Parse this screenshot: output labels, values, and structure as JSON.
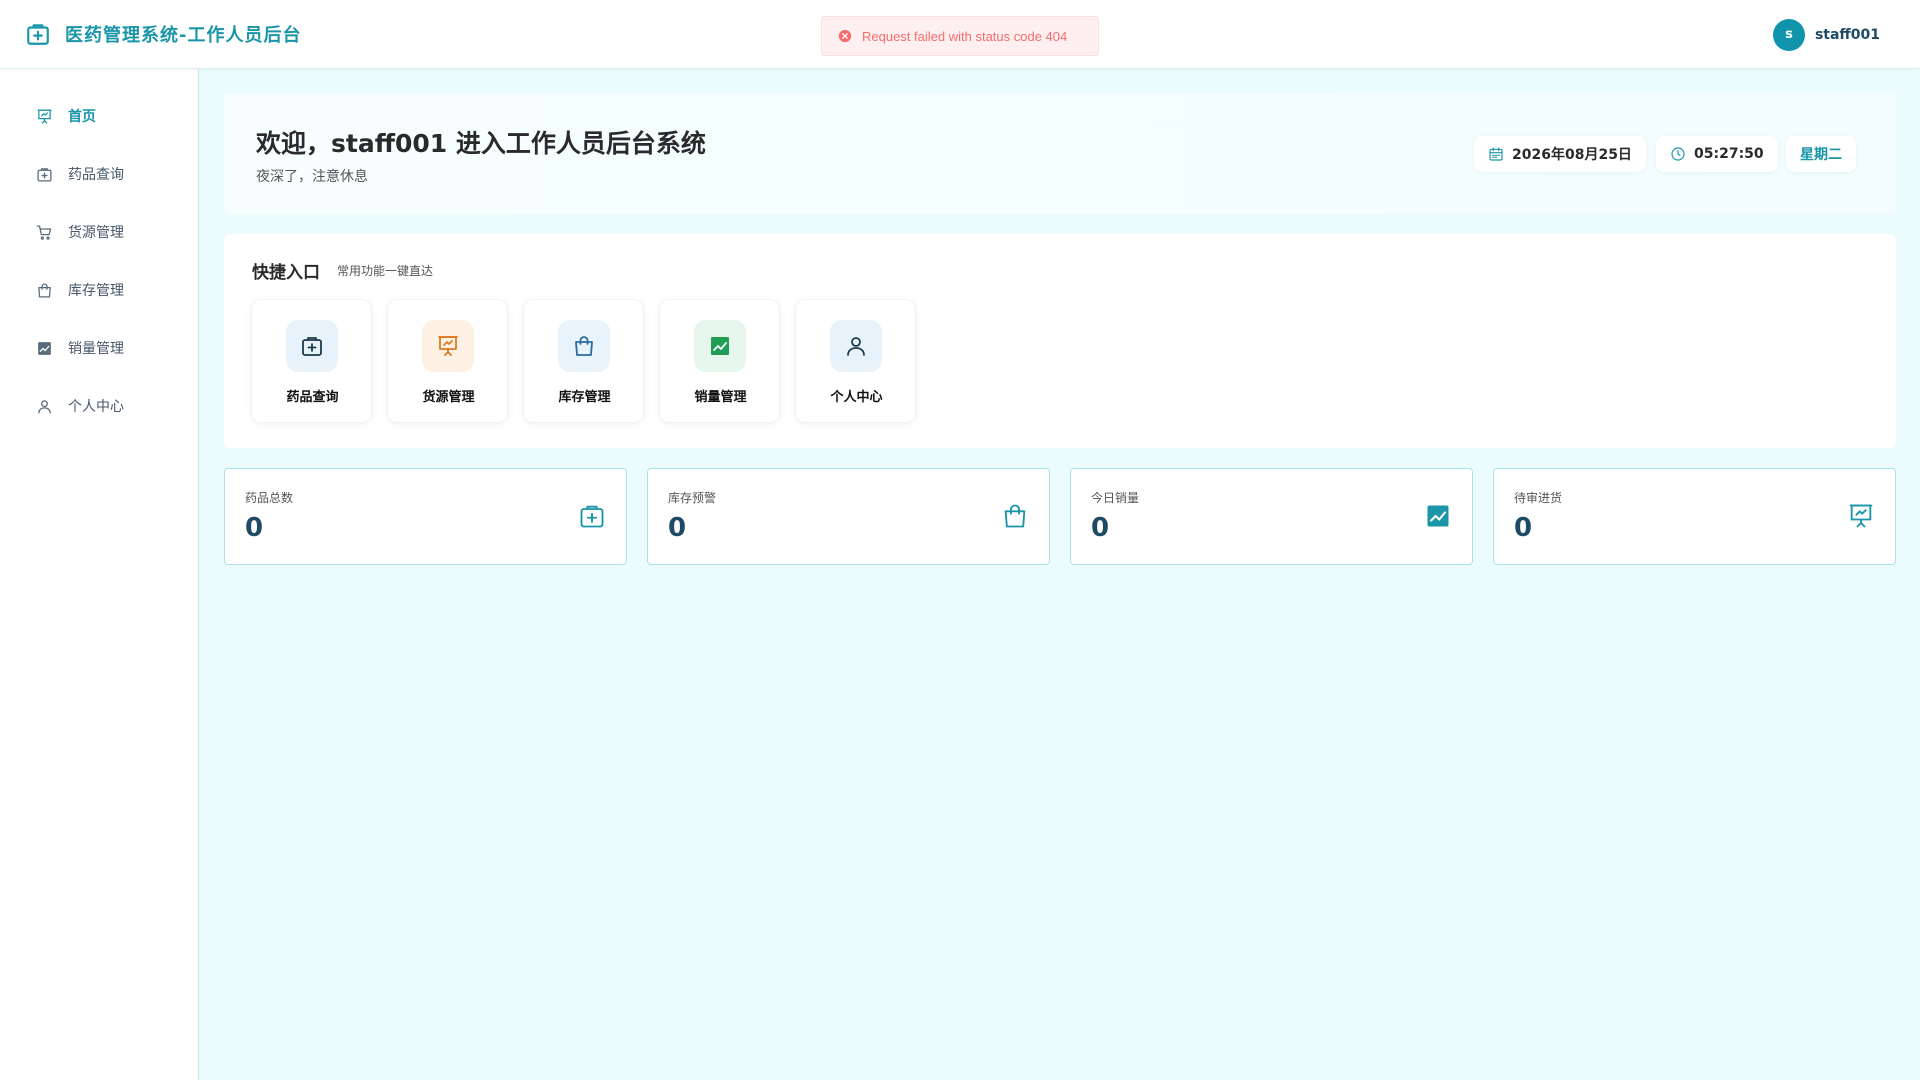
{
  "header": {
    "title": "医药管理系统-工作人员后台",
    "user": {
      "avatar_letter": "s",
      "name": "staff001"
    }
  },
  "toast": {
    "message": "Request failed with status code 404",
    "color": "#f56c6c"
  },
  "sidebar": {
    "items": [
      {
        "label": "首页",
        "icon": "chart-board-icon",
        "active": true
      },
      {
        "label": "药品查询",
        "icon": "medkit-icon",
        "active": false
      },
      {
        "label": "货源管理",
        "icon": "cart-icon",
        "active": false
      },
      {
        "label": "库存管理",
        "icon": "bag-icon",
        "active": false
      },
      {
        "label": "销量管理",
        "icon": "trend-chart-icon",
        "active": false
      },
      {
        "label": "个人中心",
        "icon": "user-icon",
        "active": false
      }
    ]
  },
  "welcome": {
    "title": "欢迎，staff001 进入工作人员后台系统",
    "subtitle": "夜深了，注意休息",
    "date": "2026年08月25日",
    "time": "05:27:50",
    "weekday": "星期二"
  },
  "quick": {
    "title": "快捷入口",
    "subtitle": "常用功能一键直达",
    "items": [
      {
        "label": "药品查询",
        "icon": "medkit-icon",
        "bg": "#e8f2fb",
        "color": "#1f3b4d"
      },
      {
        "label": "货源管理",
        "icon": "chart-board-icon",
        "bg": "#fdf1e5",
        "color": "#e07b1f"
      },
      {
        "label": "库存管理",
        "icon": "bag-icon",
        "bg": "#e8f3fb",
        "color": "#2b6c9e"
      },
      {
        "label": "销量管理",
        "icon": "trend-chart-icon",
        "bg": "#e6f6ec",
        "color": "#1f9e55"
      },
      {
        "label": "个人中心",
        "icon": "user-icon",
        "bg": "#e8f2fb",
        "color": "#1f3b4d"
      }
    ]
  },
  "stats": [
    {
      "label": "药品总数",
      "value": "0",
      "icon": "medkit-icon"
    },
    {
      "label": "库存预警",
      "value": "0",
      "icon": "bag-icon"
    },
    {
      "label": "今日销量",
      "value": "0",
      "icon": "trend-chart-icon"
    },
    {
      "label": "待审进货",
      "value": "0",
      "icon": "chart-board-icon"
    }
  ],
  "colors": {
    "accent": "#1a96a8",
    "background": "#ecfcfd"
  }
}
